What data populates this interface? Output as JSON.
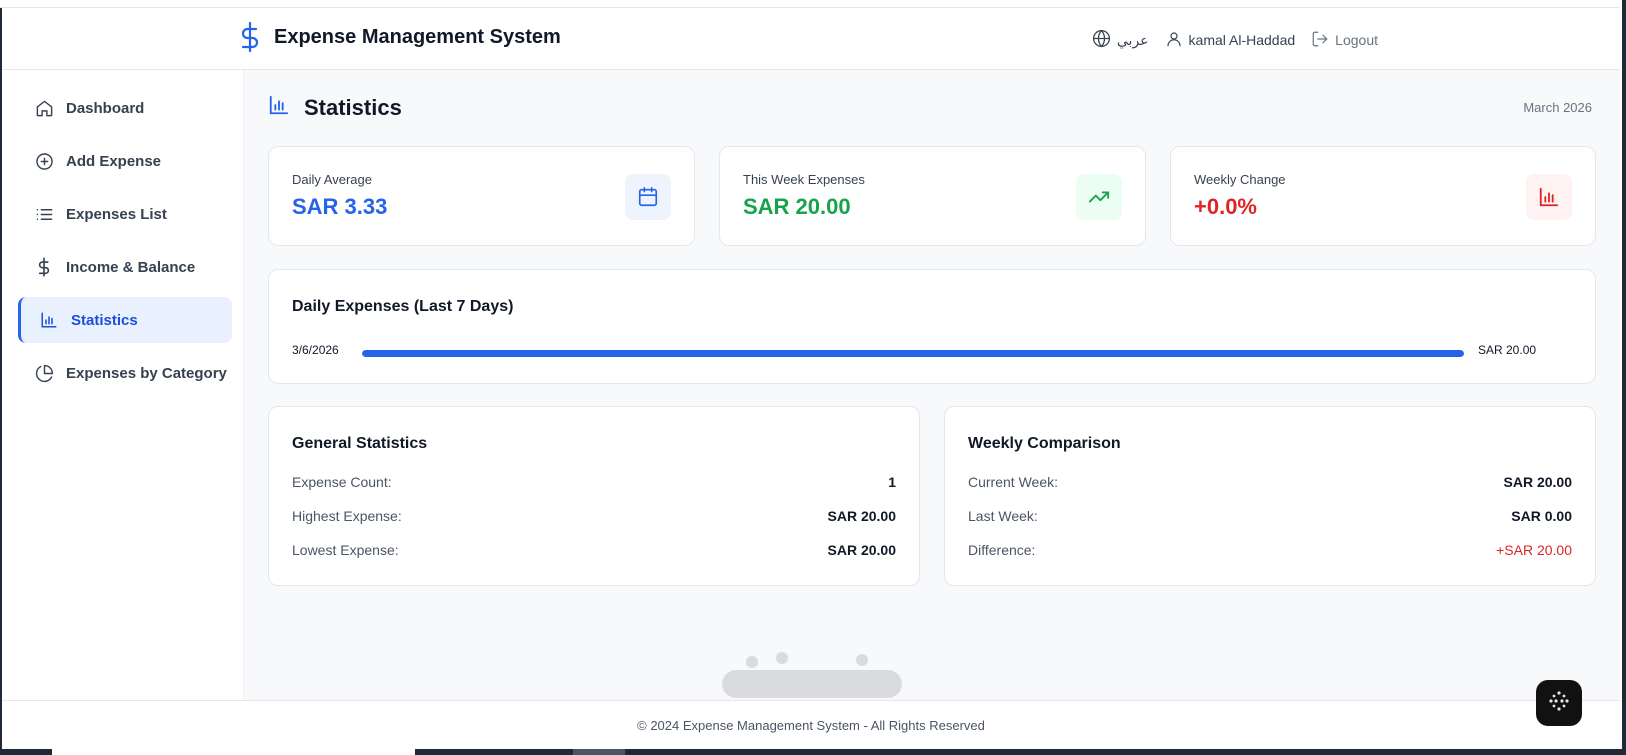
{
  "header": {
    "title": "Expense Management System",
    "language_label": "عربي",
    "user_name": "kamal Al-Haddad",
    "logout_label": "Logout"
  },
  "sidebar": {
    "items": [
      {
        "label": "Dashboard",
        "icon": "home-icon",
        "active": false
      },
      {
        "label": "Add Expense",
        "icon": "plus-circle-icon",
        "active": false
      },
      {
        "label": "Expenses List",
        "icon": "list-icon",
        "active": false
      },
      {
        "label": "Income & Balance",
        "icon": "dollar-icon",
        "active": false
      },
      {
        "label": "Statistics",
        "icon": "bar-chart-icon",
        "active": true
      },
      {
        "label": "Expenses by Category",
        "icon": "pie-chart-icon",
        "active": false
      }
    ]
  },
  "page": {
    "title": "Statistics",
    "date": "March 2026"
  },
  "stats": [
    {
      "label": "Daily Average",
      "value": "SAR 3.33",
      "color": "#2563eb",
      "icon": "calendar-icon",
      "icon_bg": "#eef4fe"
    },
    {
      "label": "This Week Expenses",
      "value": "SAR 20.00",
      "color": "#16a34a",
      "icon": "trending-up-icon",
      "icon_bg": "#ecfdf3"
    },
    {
      "label": "Weekly Change",
      "value": "+0.0%",
      "color": "#dc2626",
      "icon": "bar-chart-icon",
      "icon_bg": "#fef2f2"
    }
  ],
  "daily": {
    "title": "Daily Expenses (Last 7 Days)",
    "rows": [
      {
        "date": "3/6/2026",
        "value": "SAR 20.00",
        "fraction": 1.0
      }
    ]
  },
  "general": {
    "title": "General Statistics",
    "rows": [
      {
        "label": "Expense Count:",
        "value": "1"
      },
      {
        "label": "Highest Expense:",
        "value": "SAR 20.00"
      },
      {
        "label": "Lowest Expense:",
        "value": "SAR 20.00"
      }
    ]
  },
  "weekly": {
    "title": "Weekly Comparison",
    "rows": [
      {
        "label": "Current Week:",
        "value": "SAR 20.00"
      },
      {
        "label": "Last Week:",
        "value": "SAR 0.00"
      },
      {
        "label": "Difference:",
        "value": "+SAR 20.00"
      }
    ]
  },
  "footer": {
    "text": "© 2024 Expense Management System - All Rights Reserved"
  },
  "colors": {
    "accent": "#2563eb",
    "positive": "#16a34a",
    "negative": "#dc2626"
  }
}
